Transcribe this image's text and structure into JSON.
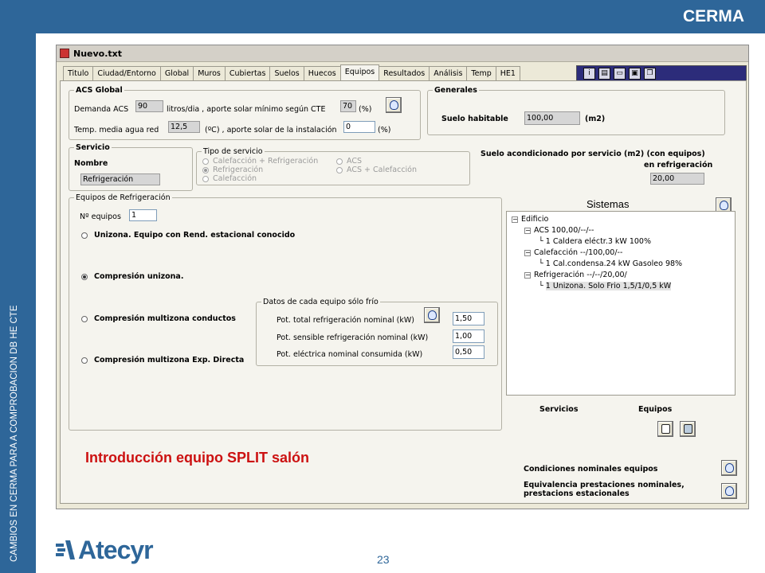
{
  "slide": {
    "brand": "CERMA",
    "side_title": "CAMBIOS EN CERMA PARA A COMPROBACION DB HE CTE",
    "page_number": "23",
    "logo_text": "Atecyr",
    "overlay_text": "Introducción equipo SPLIT salón",
    "colors": {
      "accent": "#2e6699",
      "highlight_text": "#cc1111"
    }
  },
  "window": {
    "title": "Nuevo.txt",
    "tabs": [
      "Titulo",
      "Ciudad/Entorno",
      "Global",
      "Muros",
      "Cubiertas",
      "Suelos",
      "Huecos",
      "Equipos",
      "Resultados",
      "Análisis",
      "Temp",
      "HE1"
    ],
    "active_tab": "Equipos",
    "toolbar_icons": [
      "info-icon",
      "document-icon",
      "window-icon",
      "save-icon",
      "copy-icon"
    ]
  },
  "acs_global": {
    "title": "ACS Global",
    "demanda_label": "Demanda ACS",
    "demanda_value": "90",
    "demanda_suffix": "litros/dia , aporte solar mínimo según CTE",
    "aporte_min_value": "70",
    "percent1": "(%)",
    "temp_label": "Temp. media agua red",
    "temp_value": "12,5",
    "temp_suffix": "(ºC) , aporte solar de la instalación",
    "aporte_inst_value": "0",
    "percent2": "(%)"
  },
  "generales": {
    "title": "Generales",
    "suelo_label": "Suelo habitable",
    "suelo_value": "100,00",
    "unit": "(m2)"
  },
  "servicio": {
    "title": "Servicio",
    "nombre_label": "Nombre",
    "nombre_value": "Refrigeración",
    "tipo_title": "Tipo de servicio",
    "tipo_options": [
      "Calefacción + Refrigeración",
      "Refrigeración",
      "Calefacción",
      "ACS",
      "ACS + Calefacción"
    ],
    "selected_tipo": "Refrigeración",
    "suelo_acond_label1": "Suelo acondicionado por servicio (m2)  (con equipos)",
    "suelo_acond_label2": "en refrigeración",
    "suelo_acond_value": "20,00"
  },
  "equipos": {
    "title": "Equipos de Refrigeración",
    "num_label": "Nº equipos",
    "num_value": "1",
    "options": [
      "Unizona. Equipo con Rend. estacional conocido",
      "Compresión unizona.",
      "Compresión multizona conductos",
      "Compresión multizona Exp. Directa"
    ],
    "selected_option": "Compresión unizona.",
    "datos_title": "Datos de cada equipo sólo frío",
    "datos": [
      {
        "label": "Pot. total refrigeración nominal (kW)",
        "value": "1,50"
      },
      {
        "label": "Pot. sensible refrigeración nominal (kW)",
        "value": "1,00"
      },
      {
        "label": "Pot. eléctrica nominal consumida (kW)",
        "value": "0,50"
      }
    ]
  },
  "sistemas": {
    "title": "Sistemas",
    "tree": [
      {
        "text": "Edificio",
        "level": 0,
        "expander": "-"
      },
      {
        "text": "ACS 100,00/--/--",
        "level": 1,
        "expander": "-"
      },
      {
        "text": "1 Caldera eléctr.3 kW 100%",
        "level": 2,
        "expander": ""
      },
      {
        "text": "Calefacción --/100,00/--",
        "level": 1,
        "expander": "-"
      },
      {
        "text": "1 Cal.condensa.24 kW Gasoleo 98%",
        "level": 2,
        "expander": ""
      },
      {
        "text": "Refrigeración --/--/20,00/",
        "level": 1,
        "expander": "-"
      },
      {
        "text": "1 Unizona. Solo Frio 1,5/1/0,5 kW",
        "level": 2,
        "expander": "",
        "selected": true
      }
    ],
    "servicios_label": "Servicios",
    "equipos_label": "Equipos",
    "condiciones_label": "Condiciones nominales equipos",
    "equivalencia_label1": "Equivalencia prestaciones nominales,",
    "equivalencia_label2": "prestacions estacionales"
  }
}
